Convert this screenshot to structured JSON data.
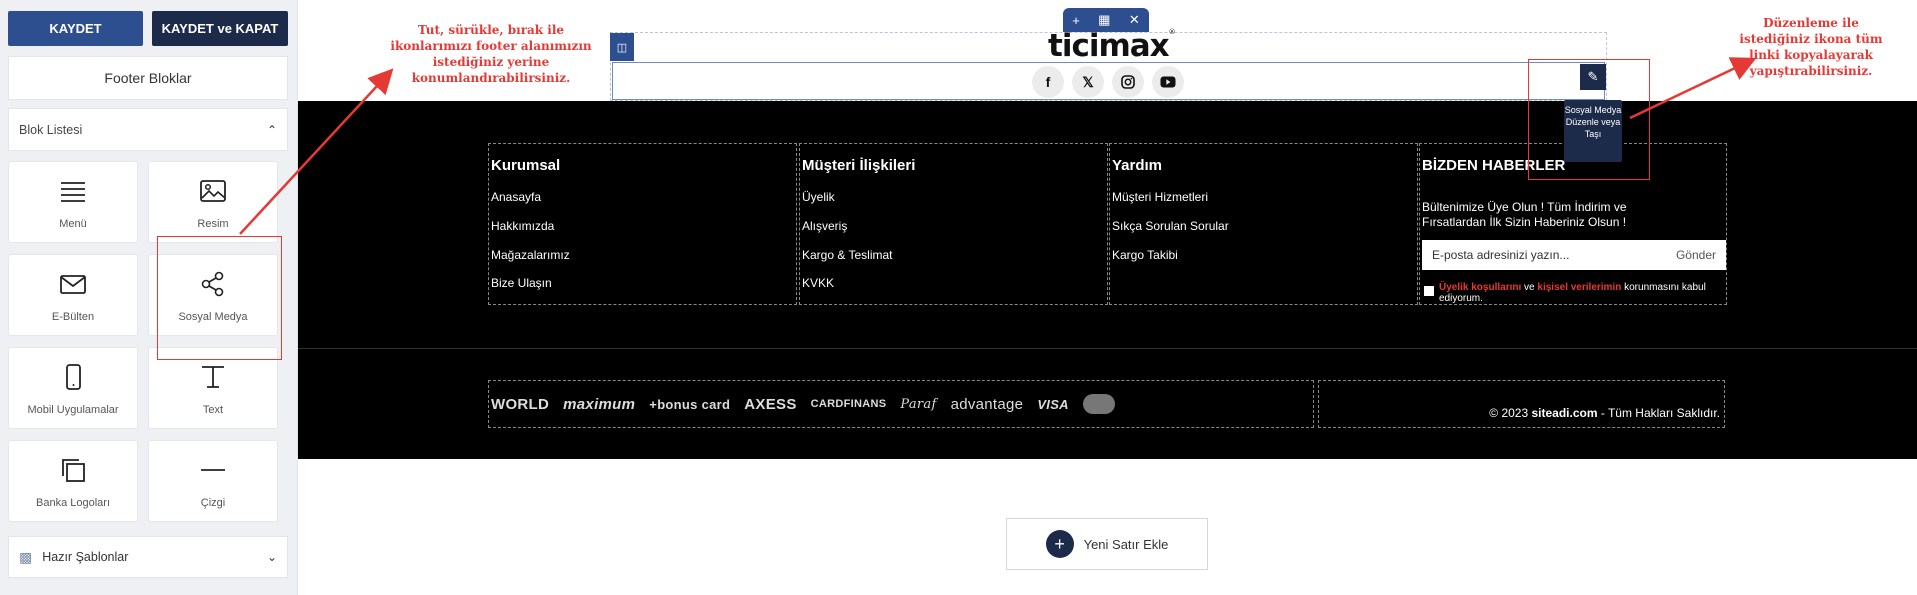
{
  "toolbar": {
    "save_label": "KAYDET",
    "save_close_label": "KAYDET ve KAPAT"
  },
  "panel": {
    "title": "Footer Bloklar",
    "block_list_label": "Blok Listesi",
    "templates_label": "Hazır Şablonlar",
    "blocks": [
      {
        "label": "Menü",
        "icon": "menu-icon"
      },
      {
        "label": "Resim",
        "icon": "image-icon"
      },
      {
        "label": "E-Bülten",
        "icon": "mail-icon"
      },
      {
        "label": "Sosyal Medya",
        "icon": "share-icon"
      },
      {
        "label": "Mobil Uygulamalar",
        "icon": "phone-icon"
      },
      {
        "label": "Text",
        "icon": "text-icon"
      },
      {
        "label": "Banka Logoları",
        "icon": "copy-icon"
      },
      {
        "label": "Çizgi",
        "icon": "line-icon"
      }
    ]
  },
  "canvas": {
    "logo_text": "ticimax",
    "logo_mark": "®",
    "social_icons": [
      "facebook-icon",
      "x-icon",
      "instagram-icon",
      "youtube-icon"
    ],
    "tooltip": "Sosyal Medya Düzenle veya Taşı",
    "columns": [
      {
        "title": "Kurumsal",
        "links": [
          "Anasayfa",
          "Hakkımızda",
          "Mağazalarımız",
          "Bize Ulaşın"
        ]
      },
      {
        "title": "Müşteri İlişkileri",
        "links": [
          "Üyelik",
          "Alışveriş",
          "Kargo & Teslimat",
          "KVKK"
        ]
      },
      {
        "title": "Yardım",
        "links": [
          "Müşteri Hizmetleri",
          "Sıkça Sorulan Sorular",
          "Kargo Takibi"
        ]
      }
    ],
    "newsletter": {
      "title": "BİZDEN HABERLER",
      "text": "Bültenimize Üye Olun ! Tüm İndirim ve Fırsatlardan İlk Sizin Haberiniz Olsun !",
      "placeholder": "E-posta adresinizi yazın...",
      "send": "Gönder",
      "consent_terms": "Üyelik koşullarını",
      "consent_and": " ve ",
      "consent_personal": "kişisel verilerimin",
      "consent_rest": " korunmasını kabul ediyorum."
    },
    "bank_logos": [
      "WORLD",
      "maximum",
      "+bonus card",
      "AXESS",
      "CARDFINANS",
      "Paraf",
      "advantage",
      "VISA"
    ],
    "copyright_prefix": "© 2023 ",
    "copyright_site": "siteadi.com",
    "copyright_suffix": " - Tüm Hakları Saklıdır.",
    "add_row_label": "Yeni Satır Ekle"
  },
  "annotations": {
    "left": "Tut, sürükle, bırak ile ikonlarımızı footer alanımızın istediğiniz yerine konumlandırabilirsiniz.",
    "right": "Düzenleme ile istediğiniz ikona tüm linki kopyalayarak yapıştırabilirsiniz."
  },
  "colors": {
    "primary": "#2d4e8f",
    "dark": "#1c2b4a",
    "annotation": "#e53935",
    "footer_bg": "#000000"
  }
}
